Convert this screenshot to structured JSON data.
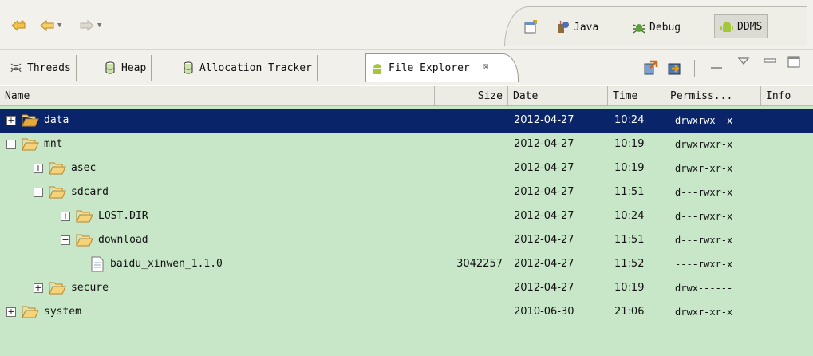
{
  "toolbar": {
    "back_icon": "back-arrow-icon",
    "forward_icon": "forward-arrow-icon",
    "perspectives": [
      {
        "label": "Java",
        "icon": "java-perspective-icon"
      },
      {
        "label": "Debug",
        "icon": "debug-perspective-icon"
      },
      {
        "label": "DDMS",
        "icon": "android-ddms-icon",
        "active": true
      }
    ]
  },
  "tabs": [
    {
      "label": "Threads",
      "icon": "threads-icon"
    },
    {
      "label": "Heap",
      "icon": "heap-icon"
    },
    {
      "label": "Allocation Tracker",
      "icon": "allocation-tracker-icon"
    },
    {
      "label": "File Explorer",
      "icon": "android-icon",
      "active": true,
      "close": "☒"
    }
  ],
  "columns": [
    "Name",
    "Size",
    "Date",
    "Time",
    "Permiss...",
    "Info"
  ],
  "rows": [
    {
      "name": "data",
      "depth": 0,
      "expander": "+",
      "type": "folder",
      "size": "",
      "date": "2012-04-27",
      "time": "10:24",
      "perm": "drwxrwx--x",
      "selected": true
    },
    {
      "name": "mnt",
      "depth": 0,
      "expander": "−",
      "type": "folder",
      "size": "",
      "date": "2012-04-27",
      "time": "10:19",
      "perm": "drwxrwxr-x"
    },
    {
      "name": "asec",
      "depth": 1,
      "expander": "+",
      "type": "folder",
      "size": "",
      "date": "2012-04-27",
      "time": "10:19",
      "perm": "drwxr-xr-x"
    },
    {
      "name": "sdcard",
      "depth": 1,
      "expander": "−",
      "type": "folder",
      "size": "",
      "date": "2012-04-27",
      "time": "11:51",
      "perm": "d---rwxr-x"
    },
    {
      "name": "LOST.DIR",
      "depth": 2,
      "expander": "+",
      "type": "folder",
      "size": "",
      "date": "2012-04-27",
      "time": "10:24",
      "perm": "d---rwxr-x"
    },
    {
      "name": "download",
      "depth": 2,
      "expander": "−",
      "type": "folder",
      "size": "",
      "date": "2012-04-27",
      "time": "11:51",
      "perm": "d---rwxr-x"
    },
    {
      "name": "baidu_xinwen_1.1.0",
      "depth": 3,
      "expander": "",
      "type": "file",
      "size": "3042257",
      "date": "2012-04-27",
      "time": "11:52",
      "perm": "----rwxr-x"
    },
    {
      "name": "secure",
      "depth": 1,
      "expander": "+",
      "type": "folder",
      "size": "",
      "date": "2012-04-27",
      "time": "10:19",
      "perm": "drwx------"
    },
    {
      "name": "system",
      "depth": 0,
      "expander": "+",
      "type": "folder",
      "size": "",
      "date": "2010-06-30",
      "time": "21:06",
      "perm": "drwxr-xr-x"
    }
  ]
}
